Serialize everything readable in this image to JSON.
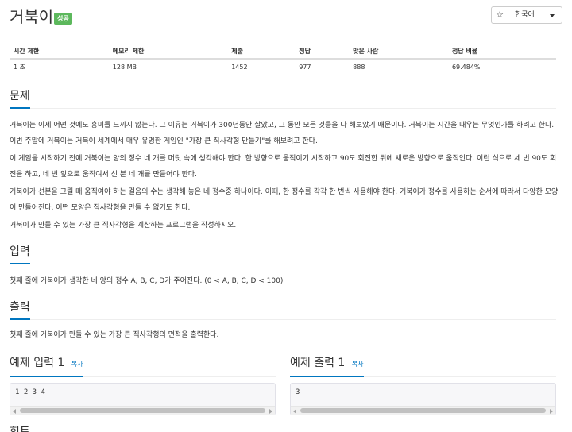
{
  "problem": {
    "title": "거북이",
    "badge": "성공"
  },
  "toolbar": {
    "star_icon": "☆",
    "language_label": "한국어"
  },
  "stats": {
    "headers": [
      "시간 제한",
      "메모리 제한",
      "제출",
      "정답",
      "맞은 사람",
      "정답 비율"
    ],
    "values": [
      "1 초",
      "128 MB",
      "1452",
      "977",
      "888",
      "69.484%"
    ]
  },
  "sections": {
    "description": {
      "heading": "문제",
      "paragraphs": [
        "거북이는 이제 어떤 것에도 흥미를 느끼지 않는다. 그 이유는 거북이가 300년동안 살았고, 그 동안 모든 것들을 다 해보았기 때문이다. 거북이는 시간을 때우는 무엇인가를 하려고 한다. 이번 주말에 거북이는 거북이 세계에서 매우 유명한 게임인 \"가장 큰 직사각형 만들기\"를 해보려고 한다.",
        "이 게임을 시작하기 전에 거북이는 양의 정수 네 개를 머릿 속에 생각해야 한다. 한 방향으로 움직이기 시작하고 90도 회전한 뒤에 새로운 방향으로 움직인다. 이런 식으로 세 번 90도 회전을 하고, 네 번 앞으로 움직여서 선 분 네 개를 만들어야 한다.",
        "거북이가 선분을 그릴 때 움직여야 하는 걸음의 수는 생각해 놓은 네 정수중 하나이다. 이때, 한 정수를 각각 한 번씩 사용해야 한다. 거북이가 정수를 사용하는 순서에 따라서 다양한 모양이 만들어진다. 어떤 모양은 직사각형을 만들 수 없기도 한다.",
        "거북이가 만들 수 있는 가장 큰 직사각형을 계산하는 프로그램을 작성하시오."
      ]
    },
    "input": {
      "heading": "입력",
      "text": "첫째 줄에 거북이가 생각한 네 양의 정수 A, B, C, D가 주어진다. (0 < A, B, C, D < 100)"
    },
    "output": {
      "heading": "출력",
      "text": "첫째 줄에 거북이가 만들 수 있는 가장 큰 직사각형의 면적을 출력한다."
    },
    "hint": {
      "heading": "힌트"
    }
  },
  "samples": {
    "copy_label": "복사",
    "input": {
      "heading": "예제 입력 1",
      "value": "1 2 3 4"
    },
    "output": {
      "heading": "예제 출력 1",
      "value": "3"
    }
  }
}
